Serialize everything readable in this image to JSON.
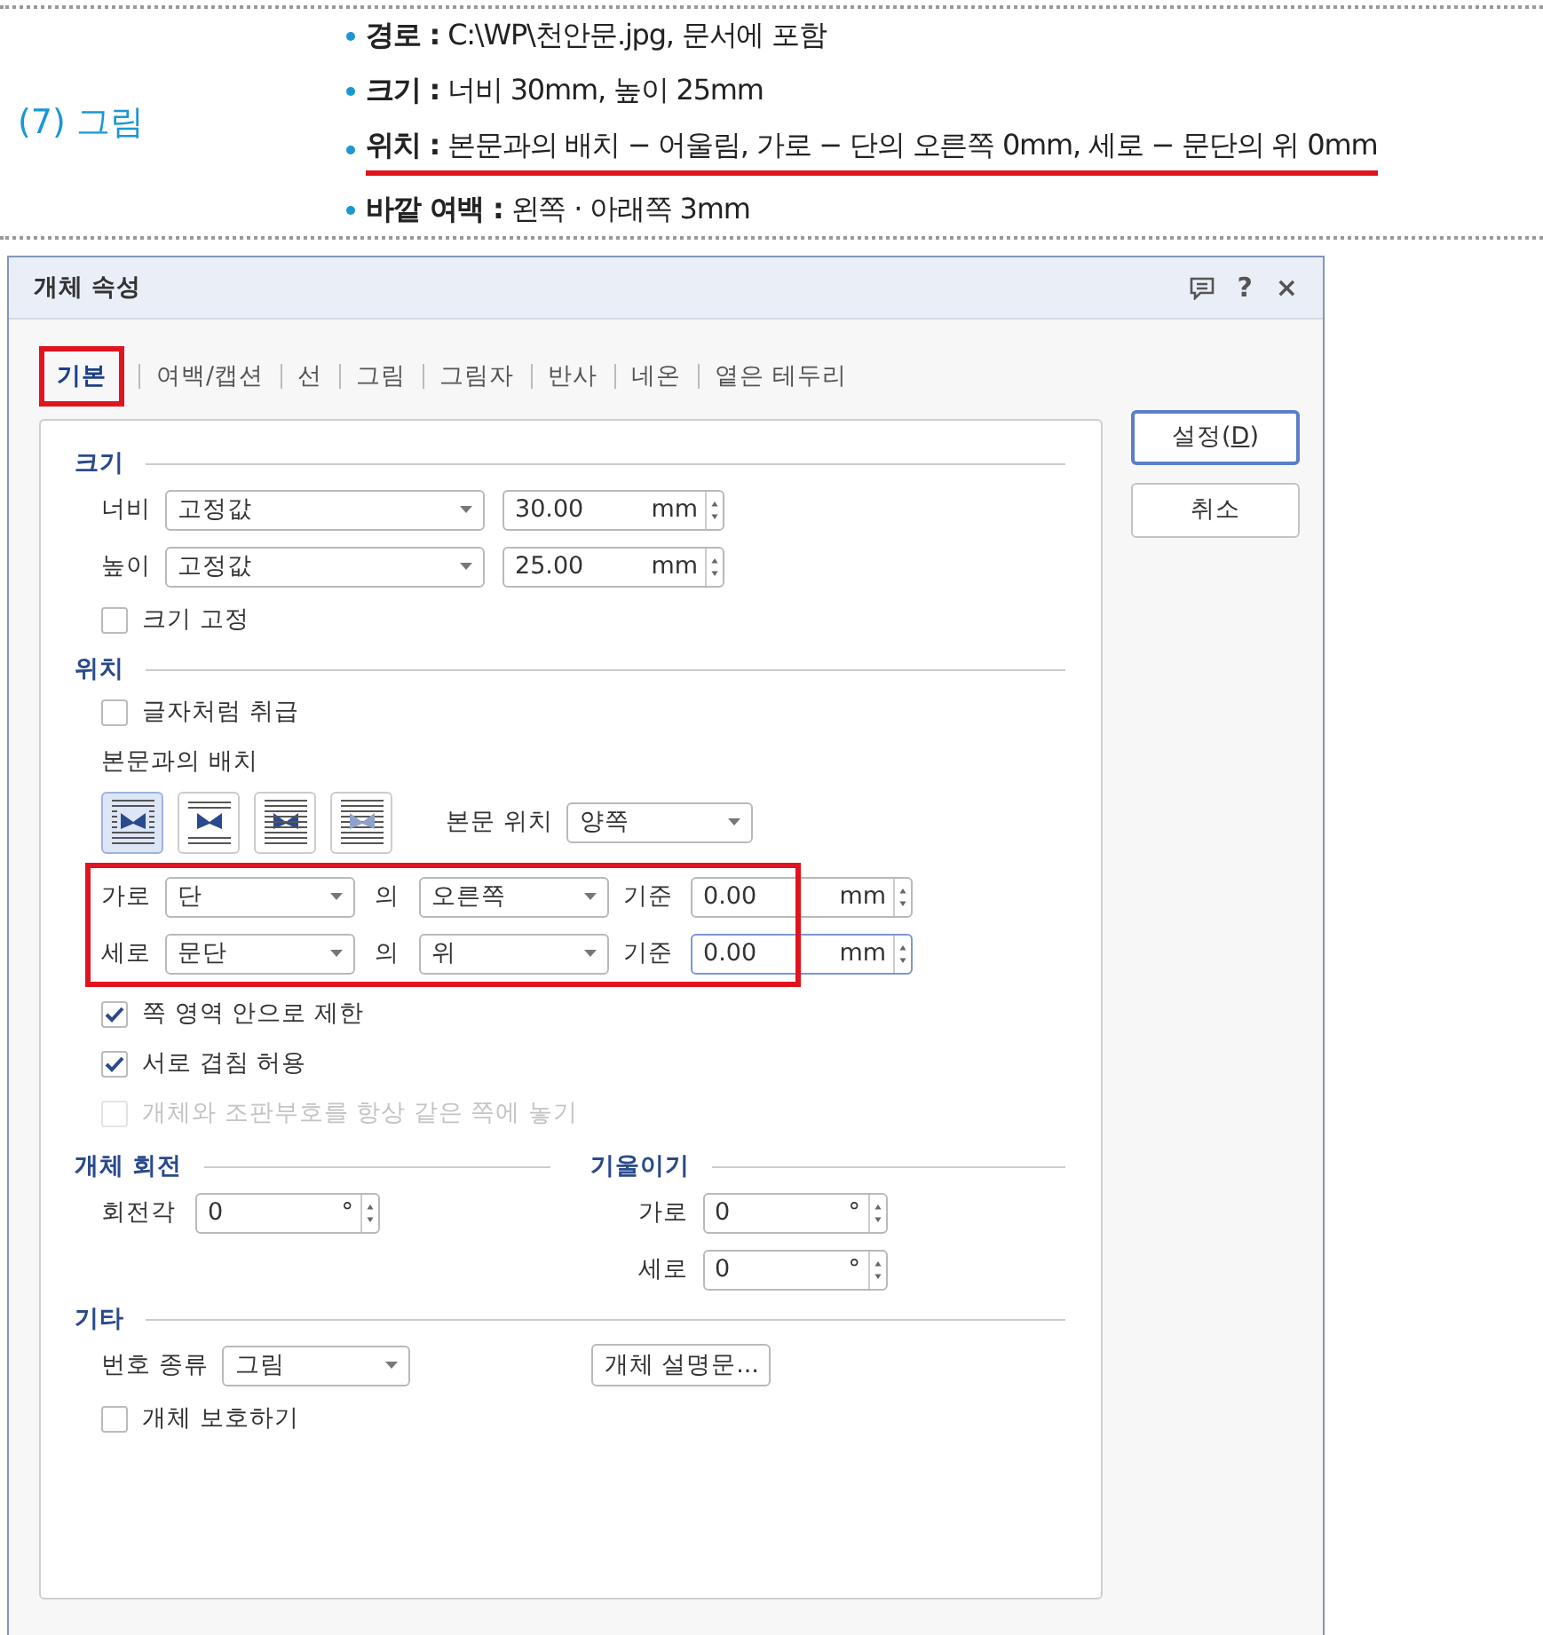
{
  "spec": {
    "label": "(7) 그림",
    "items": [
      {
        "text": "**경로 :** C:\\WP\\천안문.jpg, 문서에 포함",
        "underlined": false
      },
      {
        "text": "**크기 :** 너비 30mm, 높이 25mm",
        "underlined": false
      },
      {
        "text": "**위치 :** 본문과의 배치 − 어울림, 가로 − 단의 오른쪽 0mm, 세로 − 문단의 위 0mm",
        "underlined": true
      },
      {
        "text": "**바깥 여백 :** 왼쪽 · 아래쪽 3mm",
        "underlined": false
      }
    ]
  },
  "dialog": {
    "title": "개체 속성",
    "help_glyph": "?",
    "close_glyph": "×",
    "tabs": [
      {
        "label": "기본",
        "selected": true,
        "highlighted": true
      },
      {
        "label": "여백/캡션",
        "selected": false,
        "highlighted": false
      },
      {
        "label": "선",
        "selected": false,
        "highlighted": false
      },
      {
        "label": "그림",
        "selected": false,
        "highlighted": false
      },
      {
        "label": "그림자",
        "selected": false,
        "highlighted": false
      },
      {
        "label": "반사",
        "selected": false,
        "highlighted": false
      },
      {
        "label": "네온",
        "selected": false,
        "highlighted": false
      },
      {
        "label": "옅은 테두리",
        "selected": false,
        "highlighted": false
      }
    ],
    "size": {
      "heading": "크기",
      "fields": [
        {
          "label": "너비",
          "mode": "고정값",
          "value": "30.00",
          "unit": "mm"
        },
        {
          "label": "높이",
          "mode": "고정값",
          "value": "25.00",
          "unit": "mm"
        }
      ],
      "lock": {
        "label": "크기 고정",
        "checked": false
      }
    },
    "position": {
      "heading": "위치",
      "treat_as_char": {
        "label": "글자처럼 취급",
        "checked": false
      },
      "wrap_label": "본문과의 배치",
      "wrap_options": [
        {
          "kind": "square",
          "selected": true
        },
        {
          "kind": "topbottom",
          "selected": false
        },
        {
          "kind": "behind",
          "selected": false
        },
        {
          "kind": "front",
          "selected": false
        }
      ],
      "text_side": {
        "label": "본문 위치",
        "value": "양쪽"
      },
      "offsets": {
        "highlighted": true,
        "rows": [
          {
            "label": "가로",
            "ref": "단",
            "of": "의",
            "side": "오른쪽",
            "basis": "기준",
            "value": "0.00",
            "unit": "mm",
            "focused": false
          },
          {
            "label": "세로",
            "ref": "문단",
            "of": "의",
            "side": "위",
            "basis": "기준",
            "value": "0.00",
            "unit": "mm",
            "focused": true
          }
        ]
      },
      "options": [
        {
          "label": "쪽 영역 안으로 제한",
          "checked": true,
          "disabled": false
        },
        {
          "label": "서로 겹침 허용",
          "checked": true,
          "disabled": false
        },
        {
          "label": "개체와 조판부호를 항상 같은 쪽에 놓기",
          "checked": false,
          "disabled": true
        }
      ]
    },
    "rotation": {
      "heading": "개체 회전",
      "fields": [
        {
          "label": "회전각",
          "value": "0",
          "unit": "°"
        }
      ]
    },
    "skew": {
      "heading": "기울이기",
      "fields": [
        {
          "label": "가로",
          "value": "0",
          "unit": "°"
        },
        {
          "label": "세로",
          "value": "0",
          "unit": "°"
        }
      ]
    },
    "misc": {
      "heading": "기타",
      "number_type": {
        "label": "번호 종류",
        "value": "그림"
      },
      "description_button": "개체 설명문...",
      "protect": {
        "label": "개체 보호하기",
        "checked": false
      }
    },
    "buttons": [
      {
        "label_parts": [
          "설정(",
          "D",
          ")"
        ],
        "default": true
      },
      {
        "label_parts": [
          "취소"
        ],
        "default": false
      }
    ]
  }
}
